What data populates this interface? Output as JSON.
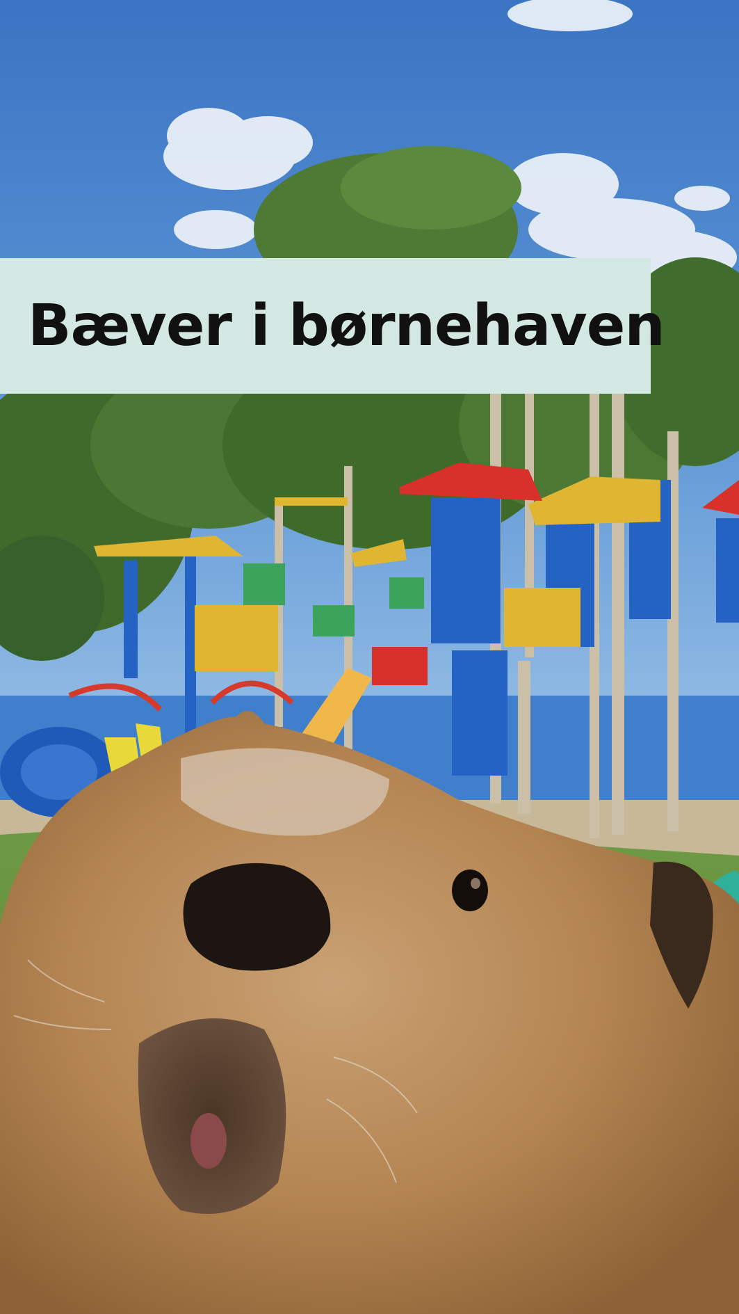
{
  "title": "Bæver i børnehaven",
  "colors": {
    "banner_background": "#d3e8e2",
    "title_text": "#111111",
    "sky": "#3f7fcb"
  },
  "illustration": {
    "subject": "beaver-close-up",
    "background": "colorful-playground-with-trees"
  }
}
